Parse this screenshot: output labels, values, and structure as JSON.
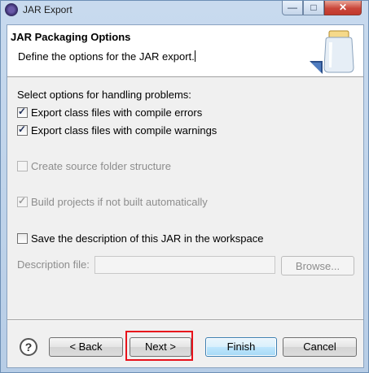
{
  "window": {
    "title": "JAR Export",
    "controls": {
      "minimize": "—",
      "maximize": "□",
      "close": "✕"
    }
  },
  "banner": {
    "title": "JAR Packaging Options",
    "description": "Define the options for the JAR export.",
    "icon": "jar-icon"
  },
  "options": {
    "group_label": "Select options for handling problems:",
    "items": [
      {
        "label": "Export class files with compile errors",
        "checked": true,
        "enabled": true
      },
      {
        "label": "Export class files with compile warnings",
        "checked": true,
        "enabled": true
      },
      {
        "label": "Create source folder structure",
        "checked": false,
        "enabled": false
      },
      {
        "label": "Build projects if not built automatically",
        "checked": true,
        "enabled": false
      },
      {
        "label": "Save the description of this JAR in the workspace",
        "checked": false,
        "enabled": true
      }
    ]
  },
  "description_file": {
    "label": "Description file:",
    "value": "",
    "browse_label": "Browse..."
  },
  "buttons": {
    "help": "?",
    "back": "< Back",
    "next": "Next >",
    "finish": "Finish",
    "cancel": "Cancel"
  },
  "colors": {
    "highlight": "#e8121b",
    "default_button_border": "#3c7fb1"
  }
}
